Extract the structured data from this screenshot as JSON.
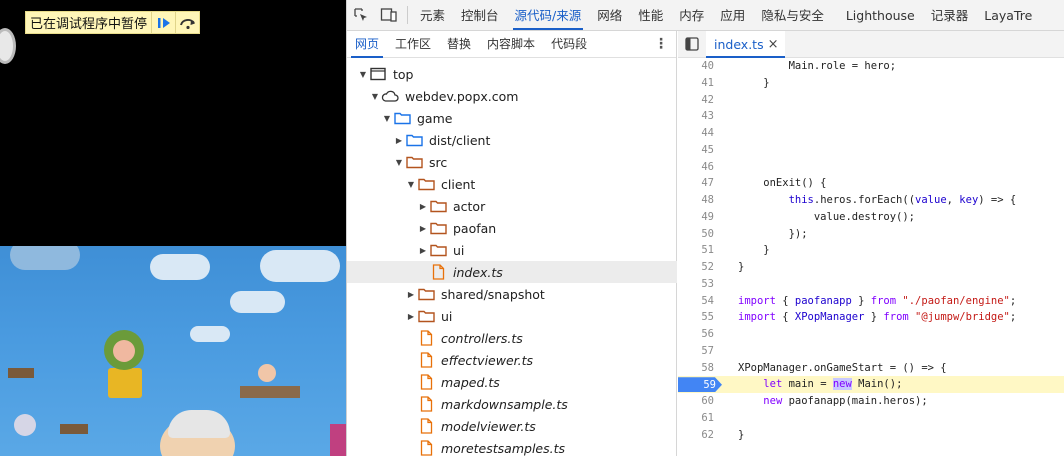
{
  "paused_banner": {
    "text": "已在调试程序中暂停"
  },
  "devtools": {
    "main_tabs": [
      "元素",
      "控制台",
      "源代码/来源",
      "网络",
      "性能",
      "内存",
      "应用",
      "隐私与安全",
      "Lighthouse",
      "记录器",
      "LayaTre"
    ],
    "active_main_tab": "源代码/来源",
    "nav_tabs": [
      "网页",
      "工作区",
      "替换",
      "内容脚本",
      "代码段"
    ],
    "active_nav_tab": "网页",
    "more_label": "⋮",
    "tree": [
      {
        "label": "top",
        "depth": 0,
        "arrow": "open",
        "icon": "frame-icon"
      },
      {
        "label": "webdev.popx.com",
        "depth": 1,
        "arrow": "open",
        "icon": "cloud-icon"
      },
      {
        "label": "game",
        "depth": 2,
        "arrow": "open",
        "icon": "folder-blue-icon"
      },
      {
        "label": "dist/client",
        "depth": 3,
        "arrow": "closed",
        "icon": "folder-blue-icon"
      },
      {
        "label": "src",
        "depth": 3,
        "arrow": "open",
        "icon": "folder-orange-icon"
      },
      {
        "label": "client",
        "depth": 4,
        "arrow": "open",
        "icon": "folder-orange-icon"
      },
      {
        "label": "actor",
        "depth": 5,
        "arrow": "closed",
        "icon": "folder-orange-icon"
      },
      {
        "label": "paofan",
        "depth": 5,
        "arrow": "closed",
        "icon": "folder-orange-icon"
      },
      {
        "label": "ui",
        "depth": 5,
        "arrow": "closed",
        "icon": "folder-orange-icon"
      },
      {
        "label": "index.ts",
        "depth": 5,
        "arrow": "none",
        "icon": "file-orange-icon",
        "selected": true
      },
      {
        "label": "shared/snapshot",
        "depth": 4,
        "arrow": "closed",
        "icon": "folder-orange-icon"
      },
      {
        "label": "ui",
        "depth": 4,
        "arrow": "closed",
        "icon": "folder-orange-icon"
      },
      {
        "label": "controllers.ts",
        "depth": 4,
        "arrow": "none",
        "icon": "file-orange-icon"
      },
      {
        "label": "effectviewer.ts",
        "depth": 4,
        "arrow": "none",
        "icon": "file-orange-icon"
      },
      {
        "label": "maped.ts",
        "depth": 4,
        "arrow": "none",
        "icon": "file-orange-icon"
      },
      {
        "label": "markdownsample.ts",
        "depth": 4,
        "arrow": "none",
        "icon": "file-orange-icon"
      },
      {
        "label": "modelviewer.ts",
        "depth": 4,
        "arrow": "none",
        "icon": "file-orange-icon"
      },
      {
        "label": "moretestsamples.ts",
        "depth": 4,
        "arrow": "none",
        "icon": "file-orange-icon"
      }
    ],
    "editor": {
      "open_file": "index.ts",
      "close_label": "×",
      "current_line": "59",
      "lines": [
        {
          "n": "40",
          "text": "        Main.role = hero;"
        },
        {
          "n": "41",
          "text": "    }"
        },
        {
          "n": "42",
          "text": ""
        },
        {
          "n": "43",
          "text": ""
        },
        {
          "n": "44",
          "text": ""
        },
        {
          "n": "45",
          "text": ""
        },
        {
          "n": "46",
          "text": ""
        },
        {
          "n": "47",
          "text": "    onExit() {"
        },
        {
          "n": "48",
          "text": "        this.heros.forEach((value, key) => {"
        },
        {
          "n": "49",
          "text": "            value.destroy();"
        },
        {
          "n": "50",
          "text": "        });"
        },
        {
          "n": "51",
          "text": "    }"
        },
        {
          "n": "52",
          "text": "}"
        },
        {
          "n": "53",
          "text": ""
        },
        {
          "n": "54",
          "text": "import { paofanapp } from \"./paofan/engine\";"
        },
        {
          "n": "55",
          "text": "import { XPopManager } from \"@jumpw/bridge\";"
        },
        {
          "n": "56",
          "text": ""
        },
        {
          "n": "57",
          "text": ""
        },
        {
          "n": "58",
          "text": "XPopManager.onGameStart = () => {"
        },
        {
          "n": "59",
          "text": "    let main = new Main();"
        },
        {
          "n": "60",
          "text": "    new paofanapp(main.heros);"
        },
        {
          "n": "61",
          "text": ""
        },
        {
          "n": "62",
          "text": "}"
        }
      ]
    }
  },
  "colors": {
    "accent": "#1a5fc8",
    "folder_blue": "#1a73e8",
    "folder_orange": "#b3541e",
    "file_orange": "#e8710a",
    "paused_bg": "#fff6b8"
  }
}
